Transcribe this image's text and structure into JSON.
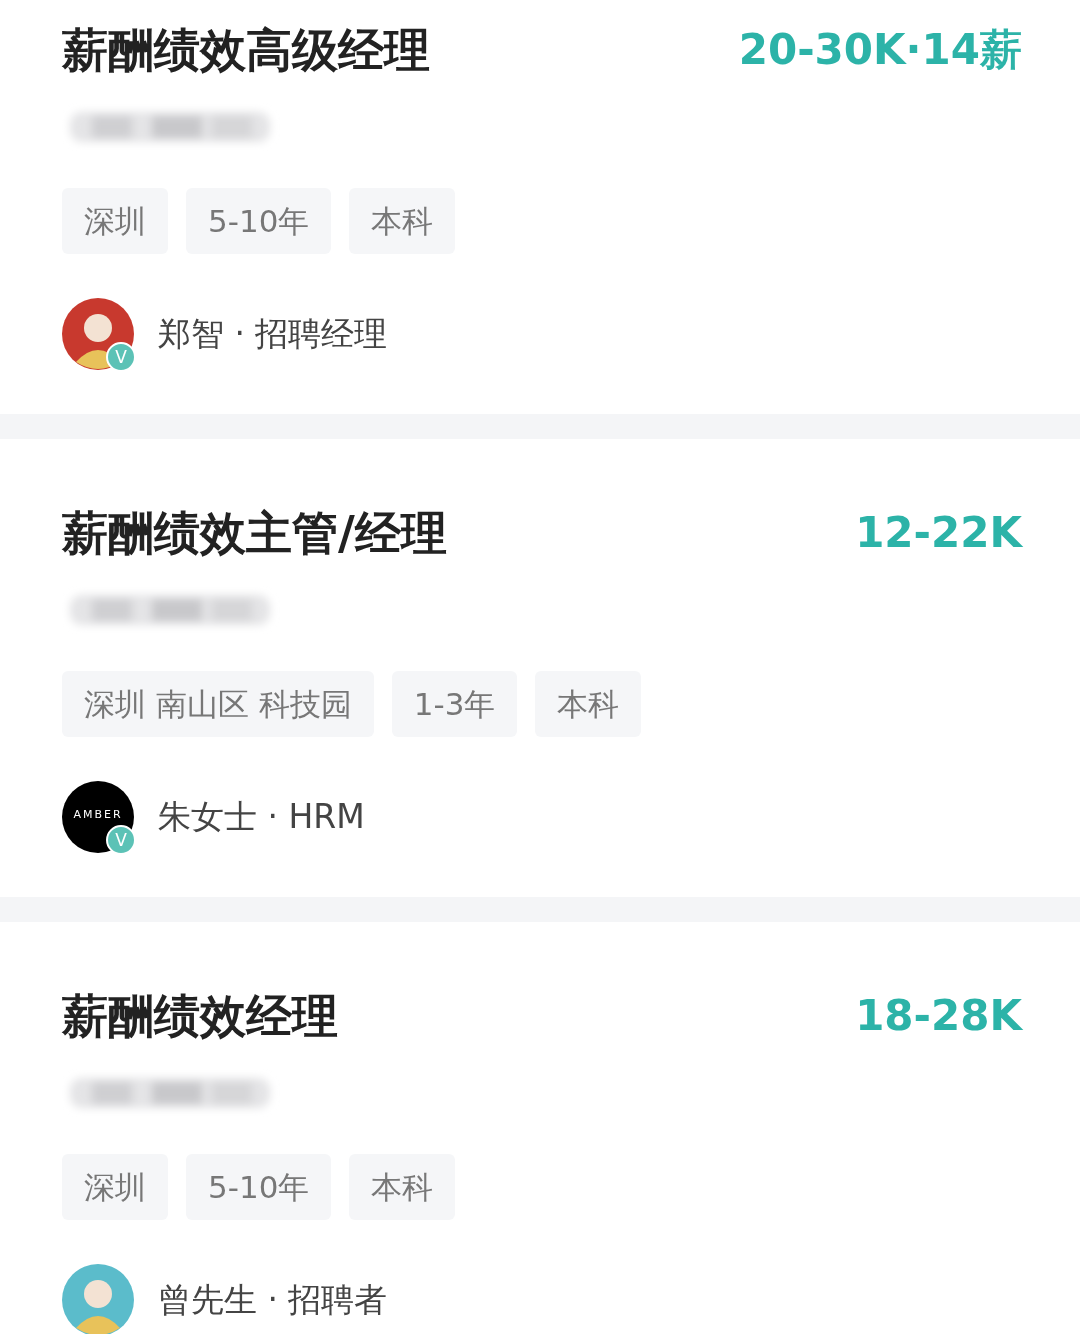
{
  "jobs": [
    {
      "title": "薪酬绩效高级经理",
      "salary": "20-30K·14薪",
      "company_redacted": true,
      "tags": [
        "深圳",
        "5-10年",
        "本科"
      ],
      "recruiter": {
        "avatar": {
          "kind": "figure",
          "color": "#c8392e"
        },
        "verified": true,
        "badge": "V",
        "name": "郑智 · 招聘经理"
      }
    },
    {
      "title": "薪酬绩效主管/经理",
      "salary": "12-22K",
      "company_redacted": true,
      "tags": [
        "深圳 南山区 科技园",
        "1-3年",
        "本科"
      ],
      "recruiter": {
        "avatar": {
          "kind": "logo",
          "text": "AMBER"
        },
        "verified": true,
        "badge": "V",
        "name": "朱女士 · HRM"
      }
    },
    {
      "title": "薪酬绩效经理",
      "salary": "18-28K",
      "company_redacted": true,
      "tags": [
        "深圳",
        "5-10年",
        "本科"
      ],
      "recruiter": {
        "avatar": {
          "kind": "figure",
          "color": "#5bbccb"
        },
        "name": "曾先生 · 招聘者"
      }
    }
  ]
}
